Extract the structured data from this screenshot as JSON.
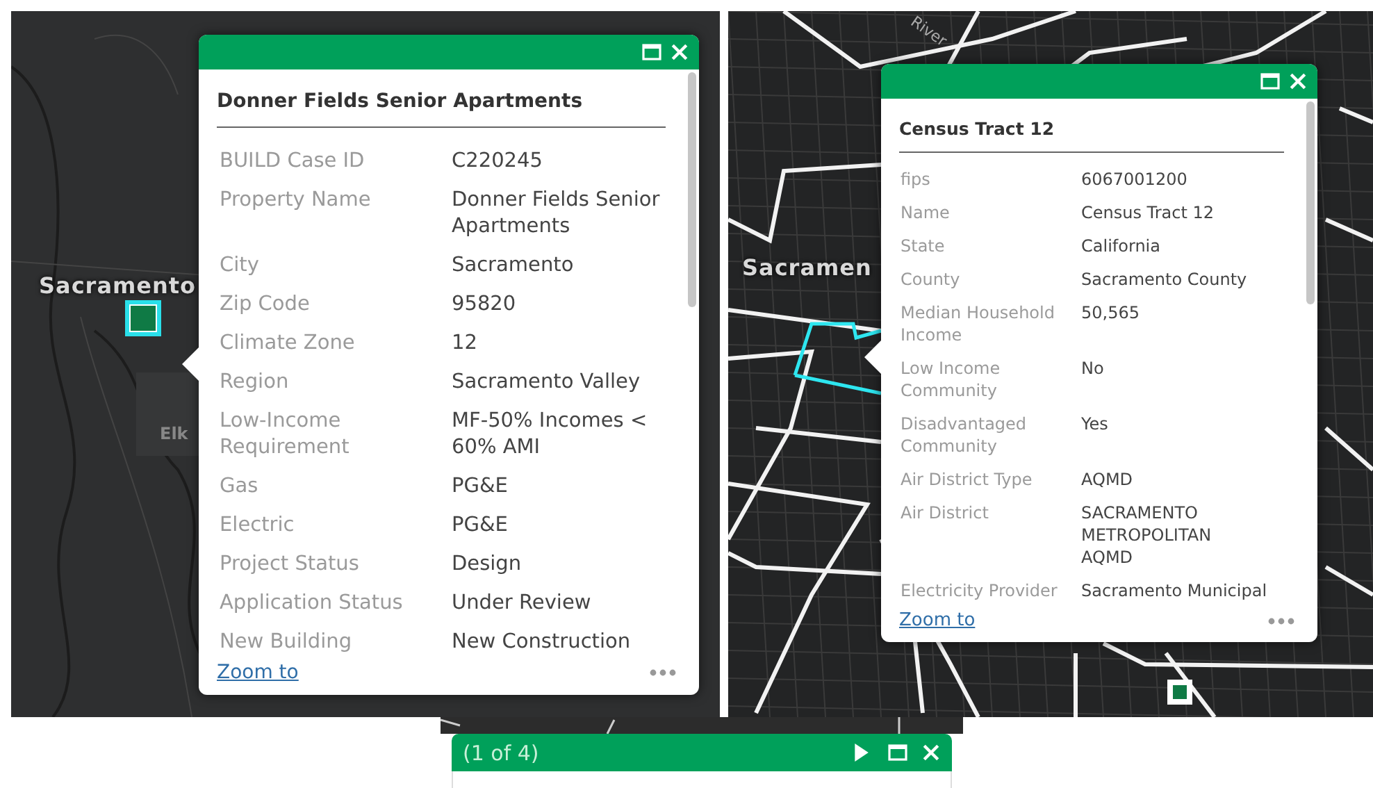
{
  "panels": [
    {
      "map": {
        "labels": [
          {
            "text": "Sacramento",
            "kind": "city"
          },
          {
            "text": "Elk",
            "kind": "town"
          }
        ],
        "marker": {
          "selected": true
        }
      },
      "popup": {
        "title": "Donner Fields Senior Apartments",
        "zoom_link": "Zoom to",
        "fields": [
          {
            "label": "BUILD Case ID",
            "value": "C220245"
          },
          {
            "label": "Property Name",
            "value": "Donner Fields Senior Apartments"
          },
          {
            "label": "City",
            "value": "Sacramento"
          },
          {
            "label": "Zip Code",
            "value": "95820"
          },
          {
            "label": "Climate Zone",
            "value": "12"
          },
          {
            "label": "Region",
            "value": "Sacramento Valley"
          },
          {
            "label": "Low-Income Requirement",
            "value": "MF-50% Incomes < 60% AMI"
          },
          {
            "label": "Gas",
            "value": "PG&E"
          },
          {
            "label": "Electric",
            "value": "PG&E"
          },
          {
            "label": "Project Status",
            "value": "Design"
          },
          {
            "label": "Application Status",
            "value": "Under Review"
          },
          {
            "label": "New Building",
            "value": "New Construction"
          }
        ]
      }
    },
    {
      "map": {
        "labels": [
          {
            "text": "Sacramen",
            "kind": "city"
          },
          {
            "text": "River",
            "kind": "water"
          }
        ],
        "marker": {
          "selected": false
        }
      },
      "popup": {
        "title": "Census Tract 12",
        "zoom_link": "Zoom to",
        "fields": [
          {
            "label": "fips",
            "value": "6067001200"
          },
          {
            "label": "Name",
            "value": "Census Tract 12"
          },
          {
            "label": "State",
            "value": "California"
          },
          {
            "label": "County",
            "value": "Sacramento County"
          },
          {
            "label": "Median Household Income",
            "value": "50,565"
          },
          {
            "label": "Low Income Community",
            "value": "No"
          },
          {
            "label": "Disadvantaged Community",
            "value": "Yes"
          },
          {
            "label": "Air District Type",
            "value": "AQMD"
          },
          {
            "label": "Air District",
            "value": "SACRAMENTO METROPOLITAN AQMD"
          },
          {
            "label": "Electricity Provider",
            "value": "Sacramento Municipal"
          }
        ]
      }
    }
  ],
  "bottom_popup": {
    "counter": "(1 of 4)"
  }
}
